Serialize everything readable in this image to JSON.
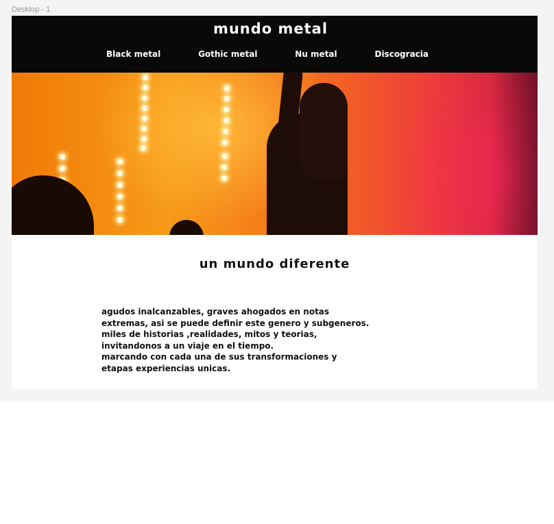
{
  "canvas": {
    "frame_label": "Desktop - 1"
  },
  "site": {
    "title": "mundo metal",
    "nav": [
      {
        "label": "Black metal"
      },
      {
        "label": "Gothic metal"
      },
      {
        "label": "Nu metal"
      },
      {
        "label": "Discogracia"
      }
    ]
  },
  "hero": {
    "image_description_icon": "concert-photo"
  },
  "content": {
    "heading": "un mundo diferente",
    "paragraph_lines": [
      "agudos inalcanzables, graves ahogados en notas",
      "extremas, asi se puede definir este genero y subgeneros.",
      "miles de historias ,realidades, mitos y teorias,",
      "invitandonos a un viaje en el tiempo.",
      "marcando con cada una de sus transformaciones y",
      "etapas experiencias unicas."
    ]
  },
  "colors": {
    "header_bg": "#090909",
    "canvas_bg": "#f4f4f4",
    "text": "#111111"
  }
}
